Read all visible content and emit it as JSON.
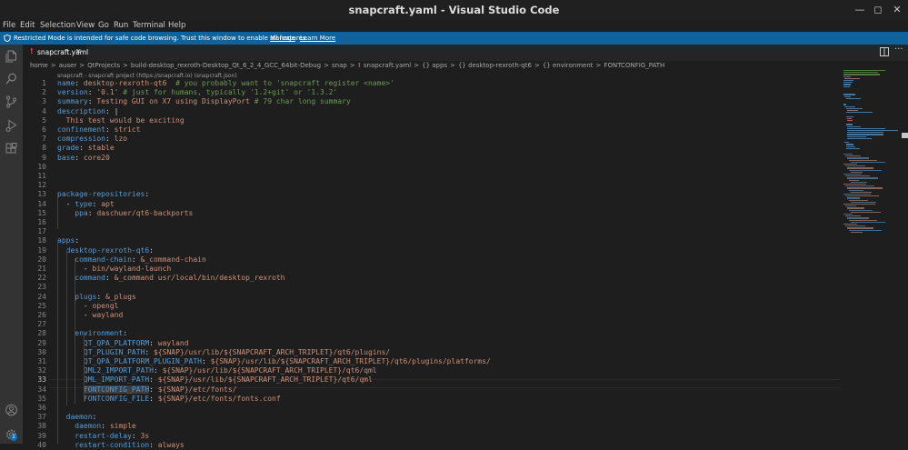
{
  "window": {
    "title": "snapcraft.yaml - Visual Studio Code"
  },
  "menu": [
    "File",
    "Edit",
    "Selection",
    "View",
    "Go",
    "Run",
    "Terminal",
    "Help"
  ],
  "banner": {
    "text": "Restricted Mode is intended for safe code browsing. Trust this window to enable all features.",
    "manage": "Manage",
    "learn_more": "Learn More"
  },
  "tab": {
    "name": "snapcraft.yaml",
    "modified_marker": "!"
  },
  "breadcrumbs": [
    "home",
    ">",
    "auser",
    ">",
    "QtProjects",
    ">",
    "build-desktop_rexroth-Desktop_Qt_6_2_4_GCC_64bit-Debug",
    ">",
    "snap",
    ">",
    "!",
    "snapcraft.yaml",
    ">",
    "{} apps",
    ">",
    "{} desktop-rexroth-qt6",
    ">",
    "{} environment",
    ">",
    "FONTCONFIG_PATH"
  ],
  "schema_hint": "snapcraft - snapcraft project (https://snapcraft.io) (snapcraft.json)",
  "active_line": 33,
  "lines": [
    {
      "n": 1,
      "t": "name: desktop-rexroth-qt6  # you probably want to 'snapcraft register <name>'"
    },
    {
      "n": 2,
      "t": "version: '0.1' # just for humans, typically '1.2+git' or '1.3.2'"
    },
    {
      "n": 3,
      "t": "summary: Testing GUI on X7 using DisplayPort # 79 char long summary"
    },
    {
      "n": 4,
      "t": "description: |"
    },
    {
      "n": 5,
      "t": "  This test would be exciting"
    },
    {
      "n": 6,
      "t": "confinement: strict"
    },
    {
      "n": 7,
      "t": "compression: lzo"
    },
    {
      "n": 8,
      "t": "grade: stable"
    },
    {
      "n": 9,
      "t": "base: core20"
    },
    {
      "n": 10,
      "t": ""
    },
    {
      "n": 11,
      "t": ""
    },
    {
      "n": 12,
      "t": ""
    },
    {
      "n": 13,
      "t": "package-repositories:"
    },
    {
      "n": 14,
      "t": "  - type: apt"
    },
    {
      "n": 15,
      "t": "    ppa: daschuer/qt6-backports"
    },
    {
      "n": 16,
      "t": ""
    },
    {
      "n": 17,
      "t": ""
    },
    {
      "n": 18,
      "t": "apps:"
    },
    {
      "n": 19,
      "t": "  desktop-rexroth-qt6:"
    },
    {
      "n": 20,
      "t": "    command-chain: &_command-chain"
    },
    {
      "n": 21,
      "t": "      - bin/wayland-launch"
    },
    {
      "n": 22,
      "t": "    command: &_command usr/local/bin/desktop_rexroth"
    },
    {
      "n": 23,
      "t": ""
    },
    {
      "n": 24,
      "t": "    plugs: &_plugs"
    },
    {
      "n": 25,
      "t": "      - opengl"
    },
    {
      "n": 26,
      "t": "      - wayland"
    },
    {
      "n": 27,
      "t": ""
    },
    {
      "n": 28,
      "t": "    environment:"
    },
    {
      "n": 29,
      "t": "      QT_QPA_PLATFORM: wayland"
    },
    {
      "n": 30,
      "t": "      QT_PLUGIN_PATH: ${SNAP}/usr/lib/${SNAPCRAFT_ARCH_TRIPLET}/qt6/plugins/"
    },
    {
      "n": 31,
      "t": "      QT_QPA_PLATFORM_PLUGIN_PATH: ${SNAP}/usr/lib/${SNAPCRAFT_ARCH_TRIPLET}/qt6/plugins/platforms/"
    },
    {
      "n": 32,
      "t": "      QML2_IMPORT_PATH: ${SNAP}/usr/lib/${SNAPCRAFT_ARCH_TRIPLET}/qt6/qml"
    },
    {
      "n": 33,
      "t": "      QML_IMPORT_PATH: ${SNAP}/usr/lib/${SNAPCRAFT_ARCH_TRIPLET}/qt6/qml"
    },
    {
      "n": 34,
      "t": "      FONTCONFIG_PATH: ${SNAP}/etc/fonts/"
    },
    {
      "n": 35,
      "t": "      FONTCONFIG_FILE: ${SNAP}/etc/fonts/fonts.conf"
    },
    {
      "n": 36,
      "t": ""
    },
    {
      "n": 37,
      "t": "  daemon:"
    },
    {
      "n": 38,
      "t": "    daemon: simple"
    },
    {
      "n": 39,
      "t": "    restart-delay: 3s"
    },
    {
      "n": 40,
      "t": "    restart-condition: always"
    }
  ],
  "accounts_badge": "1",
  "colors": {
    "key": "#569cd6",
    "string": "#ce9178",
    "comment": "#6a9955",
    "banner": "#0e639c",
    "activitybar": "#333333"
  },
  "icons": [
    "explorer-icon",
    "search-icon",
    "source-control-icon",
    "run-debug-icon",
    "extensions-icon",
    "accounts-icon",
    "settings-gear-icon",
    "split-editor-icon",
    "more-actions-icon",
    "close-icon"
  ]
}
